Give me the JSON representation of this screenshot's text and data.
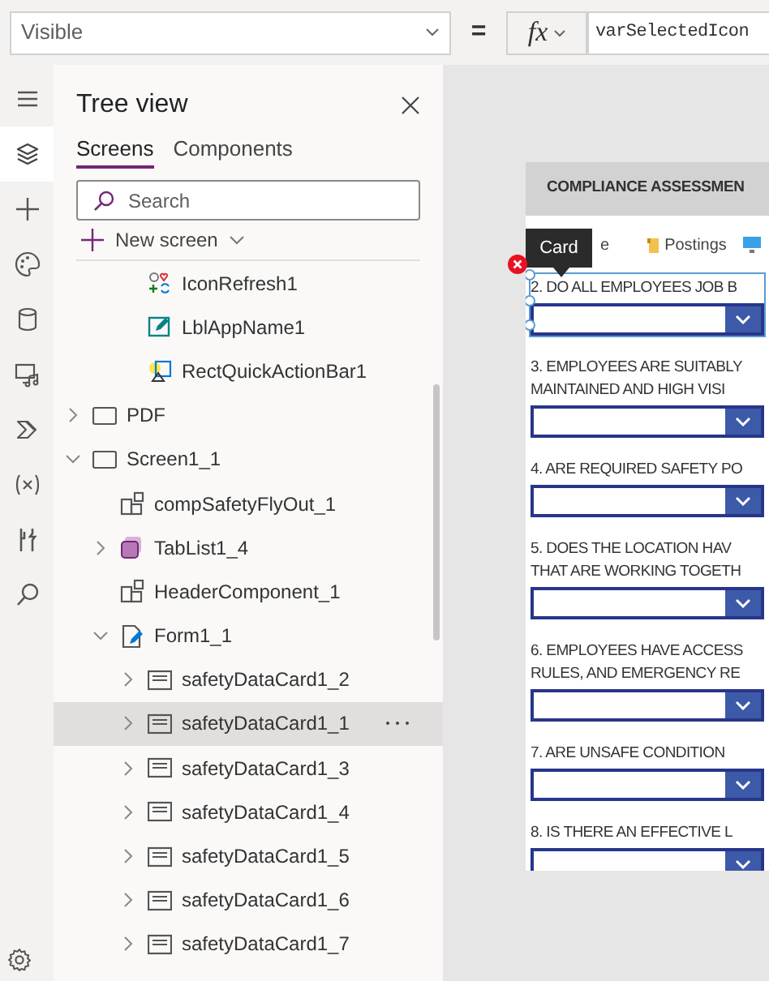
{
  "formula_bar": {
    "property": "Visible",
    "equals": "=",
    "fx": "fx",
    "formula": "varSelectedIcon"
  },
  "rail": [
    {
      "selected": false
    },
    {
      "selected": true
    },
    {
      "selected": false
    },
    {
      "selected": false
    },
    {
      "selected": false
    },
    {
      "selected": false
    },
    {
      "selected": false
    },
    {
      "selected": false
    },
    {
      "selected": false
    },
    {
      "selected": false
    }
  ],
  "tree_panel": {
    "title": "Tree view",
    "tabs": [
      {
        "label": "Screens",
        "selected": true
      },
      {
        "label": "Components",
        "selected": false
      }
    ],
    "search": {
      "placeholder": "Search"
    },
    "new_screen": "New screen",
    "partial_children": [
      {
        "label": "IconRefresh1",
        "kind": "icon",
        "selected": false
      },
      {
        "label": "LblAppName1",
        "kind": "label",
        "selected": false
      },
      {
        "label": "RectQuickActionBar1",
        "kind": "shape",
        "selected": false
      }
    ],
    "items": [
      {
        "label": "PDF",
        "kind": "screen",
        "expanded": false,
        "selected": false
      },
      {
        "label": "Screen1_1",
        "kind": "screen",
        "expanded": true,
        "selected": false,
        "children": [
          {
            "label": "compSafetyFlyOut_1",
            "kind": "component",
            "selected": false
          },
          {
            "label": "TabList1_4",
            "kind": "gallery",
            "expanded": false,
            "selected": false
          },
          {
            "label": "HeaderComponent_1",
            "kind": "component",
            "selected": false
          },
          {
            "label": "Form1_1",
            "kind": "form",
            "expanded": true,
            "selected": false,
            "children": [
              {
                "label": "safetyDataCard1_2",
                "kind": "card",
                "expanded": false,
                "selected": false
              },
              {
                "label": "safetyDataCard1_1",
                "kind": "card",
                "expanded": false,
                "selected": true
              },
              {
                "label": "safetyDataCard1_3",
                "kind": "card",
                "expanded": false,
                "selected": false
              },
              {
                "label": "safetyDataCard1_4",
                "kind": "card",
                "expanded": false,
                "selected": false
              },
              {
                "label": "safetyDataCard1_5",
                "kind": "card",
                "expanded": false,
                "selected": false
              },
              {
                "label": "safetyDataCard1_6",
                "kind": "card",
                "expanded": false,
                "selected": false
              },
              {
                "label": "safetyDataCard1_7",
                "kind": "card",
                "expanded": false,
                "selected": false
              }
            ]
          }
        ]
      }
    ]
  },
  "app_screen": {
    "header": "COMPLIANCE ASSESSMEN",
    "tabs": [
      {
        "label": "e"
      },
      {
        "label": "Postings"
      }
    ],
    "tooltip": "Card",
    "questions": [
      {
        "lines": [
          "2. DO ALL EMPLOYEES JOB B"
        ],
        "selected": true
      },
      {
        "lines": [
          "3. EMPLOYEES ARE SUITABLY",
          "MAINTAINED AND HIGH VISI"
        ],
        "selected": false
      },
      {
        "lines": [
          "4. ARE REQUIRED SAFETY PO"
        ],
        "selected": false
      },
      {
        "lines": [
          "5. DOES THE LOCATION HAV",
          "THAT ARE WORKING TOGETH"
        ],
        "selected": false
      },
      {
        "lines": [
          "6. EMPLOYEES HAVE ACCESS",
          "RULES, AND EMERGENCY RE"
        ],
        "selected": false
      },
      {
        "lines": [
          "7. ARE UNSAFE CONDITION"
        ],
        "selected": false
      },
      {
        "lines": [
          "8. IS THERE AN EFFECTIVE L"
        ],
        "selected": false
      }
    ]
  }
}
